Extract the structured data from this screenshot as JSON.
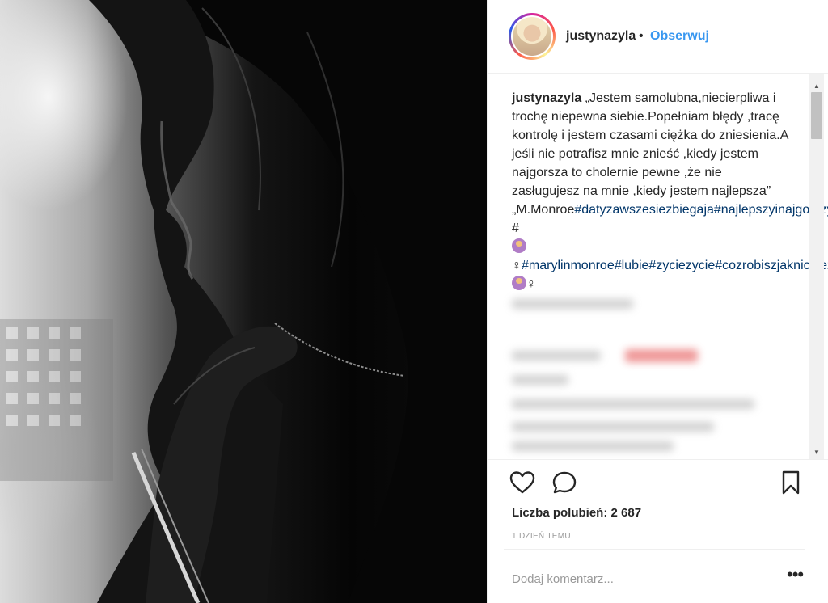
{
  "post": {
    "username": "justynazyla",
    "header_separator": "•",
    "follow_label": "Obserwuj",
    "caption_username": "justynazyla",
    "caption_text_1": " „Jestem samolubna,niecierpliwa i trochę niepewna siebie.Popełniam błędy ,tracę kontrolę i jestem czasami ciężka do zniesienia.A jeśli nie potrafisz mnie znieść ,kiedy jestem najgorsza to cholernie pewne ,że nie zasługujesz na mnie ,kiedy jestem najlepsza”",
    "caption_text_2": "„M.Monroe",
    "hashtag_1": "#datyzawszesiezbiegaja",
    "hashtag_2": "#najlepszyinajgorszydzienwzyciu",
    "hash_space": " #",
    "female_sign_1": "♀",
    "hashtag_3": "#marylinmonroe",
    "hashtag_4": "#lubie",
    "hashtag_5": "#zyciezycie",
    "hashtag_6": "#cozrobiszjaknicniezrobisz",
    "female_sign_2": "♀",
    "likes_label": "Liczba polubień:",
    "likes_count": "2 687",
    "timestamp": "1 dzień temu",
    "comment_placeholder": "Dodaj komentarz...",
    "more_label": "•••"
  },
  "icons": {
    "like": "heart-icon",
    "comment": "speech-bubble-icon",
    "bookmark": "bookmark-icon",
    "avatar": "profile-photo",
    "emoji": "person-gesturing-no-emoji"
  },
  "colors": {
    "link_blue": "#3897f0",
    "hashtag": "#003569",
    "text": "#262626",
    "muted": "#999999"
  }
}
